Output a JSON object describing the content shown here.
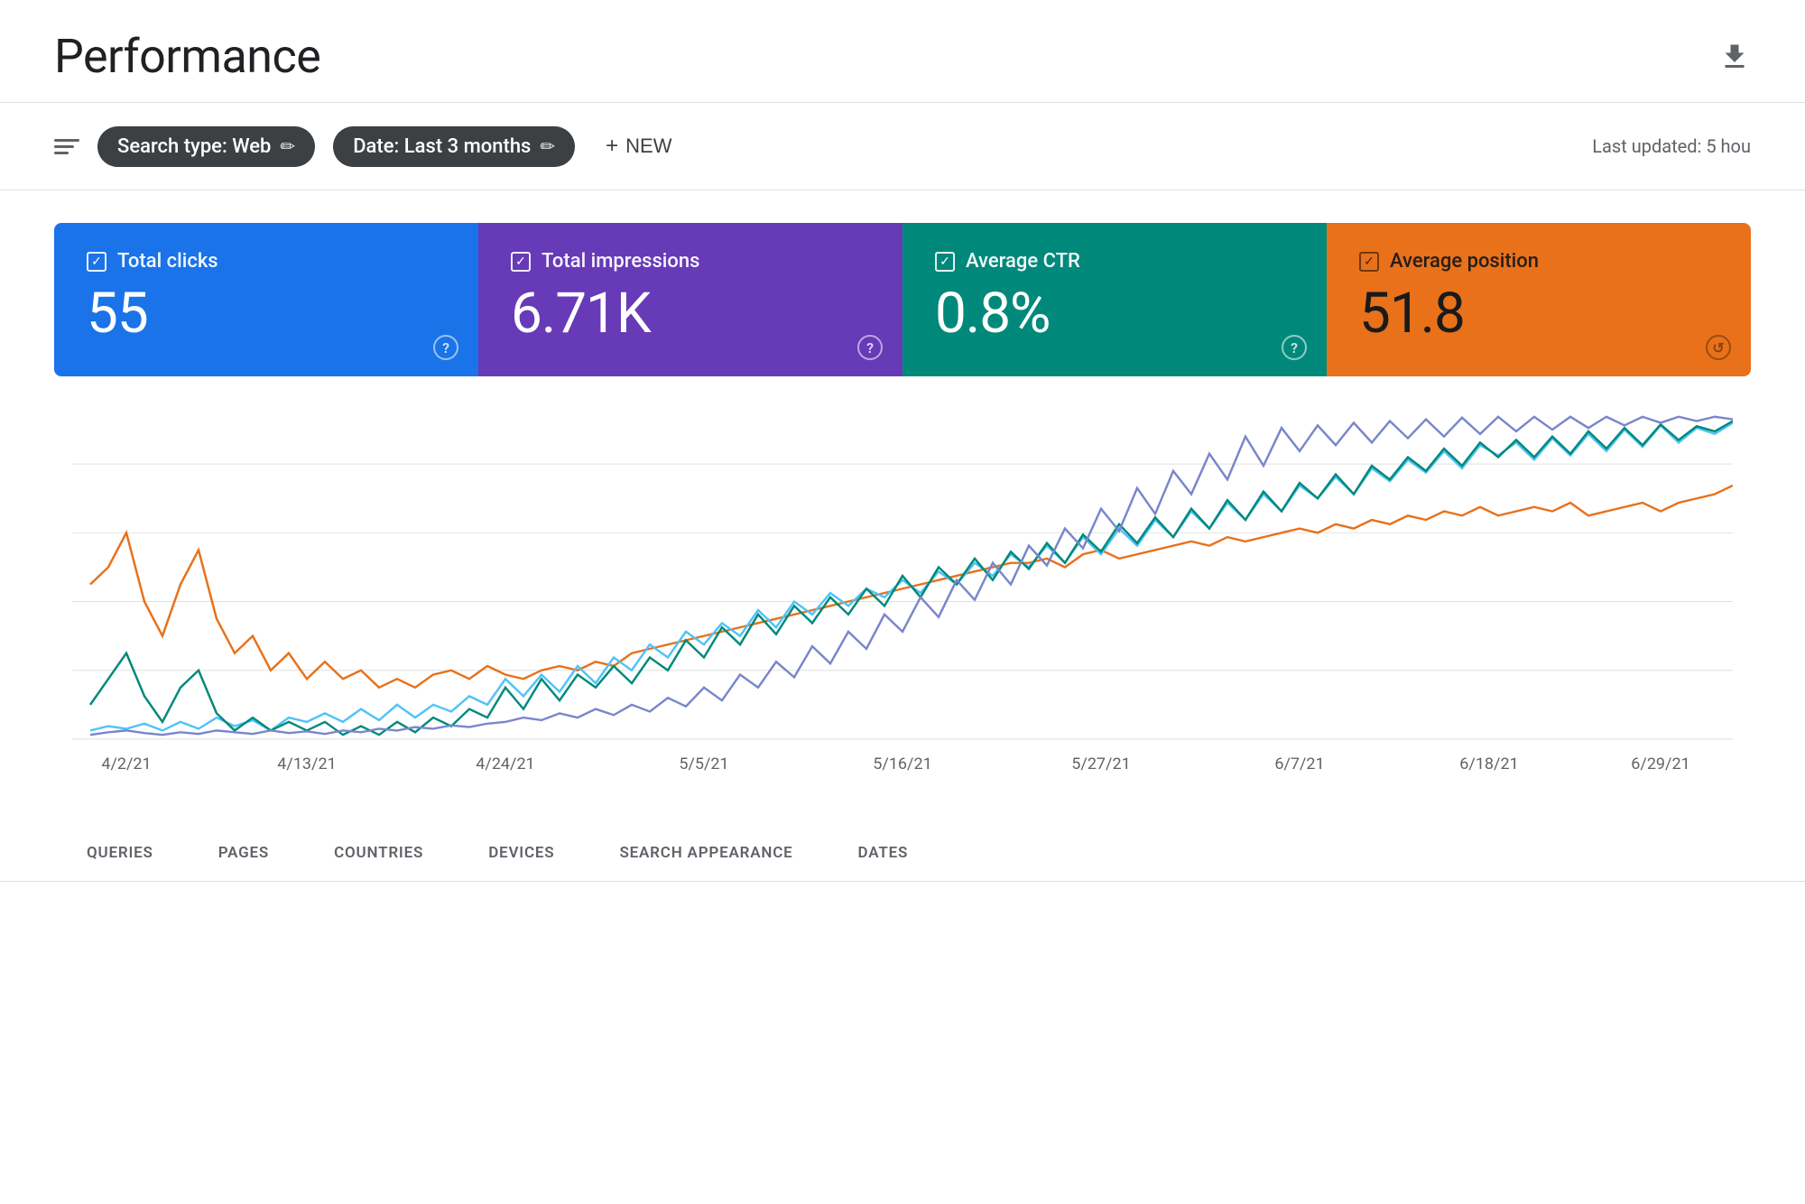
{
  "header": {
    "title": "Performance",
    "download_label": "⬇"
  },
  "toolbar": {
    "search_type_label": "Search type: Web",
    "date_label": "Date: Last 3 months",
    "new_button_label": "NEW",
    "last_updated_label": "Last updated: 5 hou"
  },
  "metrics": [
    {
      "id": "clicks",
      "label": "Total clicks",
      "value": "55",
      "checked": true,
      "color": "#1a73e8"
    },
    {
      "id": "impressions",
      "label": "Total impressions",
      "value": "6.71K",
      "checked": true,
      "color": "#673ab7"
    },
    {
      "id": "ctr",
      "label": "Average CTR",
      "value": "0.8%",
      "checked": true,
      "color": "#00897b"
    },
    {
      "id": "position",
      "label": "Average position",
      "value": "51.8",
      "checked": true,
      "color": "#e8711a"
    }
  ],
  "chart": {
    "x_labels": [
      "4/2/21",
      "4/13/21",
      "4/24/21",
      "5/5/21",
      "5/16/21",
      "5/27/21",
      "6/7/21",
      "6/18/21",
      "6/29/21"
    ],
    "lines": {
      "clicks_color": "#e8711a",
      "impressions_color": "#1a73e8",
      "ctr_color": "#00897b",
      "position_color": "#673ab7"
    }
  },
  "bottom_tabs": [
    {
      "label": "QUERIES",
      "active": false
    },
    {
      "label": "PAGES",
      "active": false
    },
    {
      "label": "COUNTRIES",
      "active": false
    },
    {
      "label": "DEVICES",
      "active": false
    },
    {
      "label": "SEARCH APPEARANCE",
      "active": false
    },
    {
      "label": "DATES",
      "active": false
    }
  ]
}
